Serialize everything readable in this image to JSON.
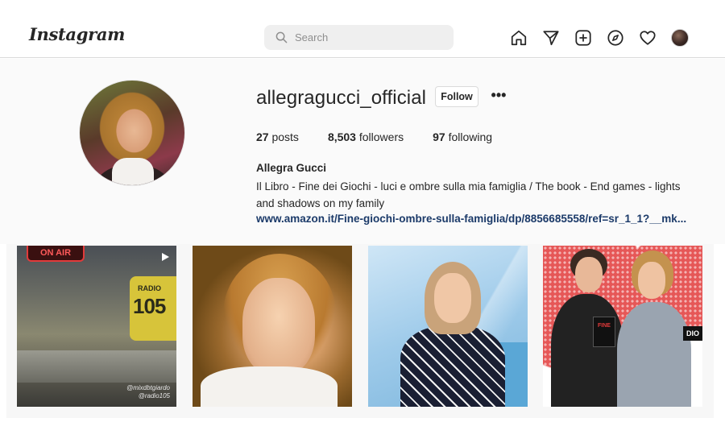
{
  "header": {
    "logo_text": "Instagram",
    "search_placeholder": "Search",
    "nav_icons": [
      "home-icon",
      "direct-message-icon",
      "new-post-icon",
      "explore-icon",
      "activity-heart-icon",
      "profile-avatar"
    ]
  },
  "profile": {
    "username": "allegragucci_official",
    "follow_label": "Follow",
    "more_label": "•••",
    "stats": {
      "posts_count": "27",
      "posts_label": "posts",
      "followers_count": "8,503",
      "followers_label": "followers",
      "following_count": "97",
      "following_label": "following"
    },
    "bio_name": "Allegra Gucci",
    "bio_text": "Il Libro - Fine dei Giochi - luci e ombre sulla mia famiglia / The book - End games - lights and shadows on my family",
    "bio_link": "www.amazon.it/Fine-giochi-ombre-sulla-famiglia/dp/8856685558/ref=sr_1_1?__mk..."
  },
  "posts": [
    {
      "type": "video",
      "sign_text": "ON AIR",
      "radio_word": "RADIO",
      "radio_number": "105",
      "caption": "@mixdbtgiardo\n@radio105"
    },
    {
      "type": "photo"
    },
    {
      "type": "photo"
    },
    {
      "type": "photo",
      "book_text": "FINE",
      "sign_text": "DIO"
    }
  ],
  "colors": {
    "link": "#1b3a69",
    "border": "#dbdbdb",
    "band_bg": "#fafafa"
  }
}
